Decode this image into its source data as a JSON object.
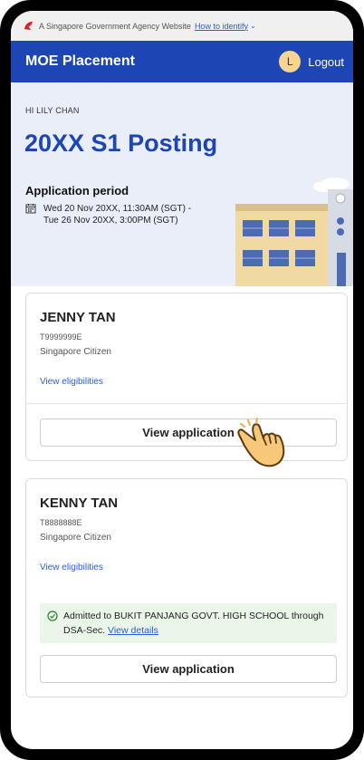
{
  "gov_banner": {
    "text": "A Singapore Government Agency Website",
    "link": "How to identify",
    "chevron": "chevron-down-icon"
  },
  "header": {
    "title": "MOE Placement",
    "avatar_initial": "L",
    "logout_label": "Logout"
  },
  "hero": {
    "greeting": "HI LILY CHAN",
    "title": "20XX S1 Posting",
    "period_label": "Application period",
    "period_line1": "Wed 20 Nov 20XX, 11:30AM (SGT) -",
    "period_line2": "Tue 26 Nov 20XX, 3:00PM (SGT)"
  },
  "children": [
    {
      "name": "JENNY TAN",
      "id": "T9999999E",
      "status": "Singapore Citizen",
      "eligibility_link": "View eligibilities",
      "button": "View application"
    },
    {
      "name": "KENNY TAN",
      "id": "T8888888E",
      "status": "Singapore Citizen",
      "eligibility_link": "View eligibilities",
      "admission_text": "Admitted to BUKIT PANJANG GOVT. HIGH SCHOOL through DSA-Sec.",
      "admission_link": "View details",
      "button": "View application"
    }
  ],
  "colors": {
    "brand": "#1d45b4",
    "hero_bg": "#e9eef9",
    "link": "#2b5bd7",
    "success_bg": "#eaf6e8"
  }
}
